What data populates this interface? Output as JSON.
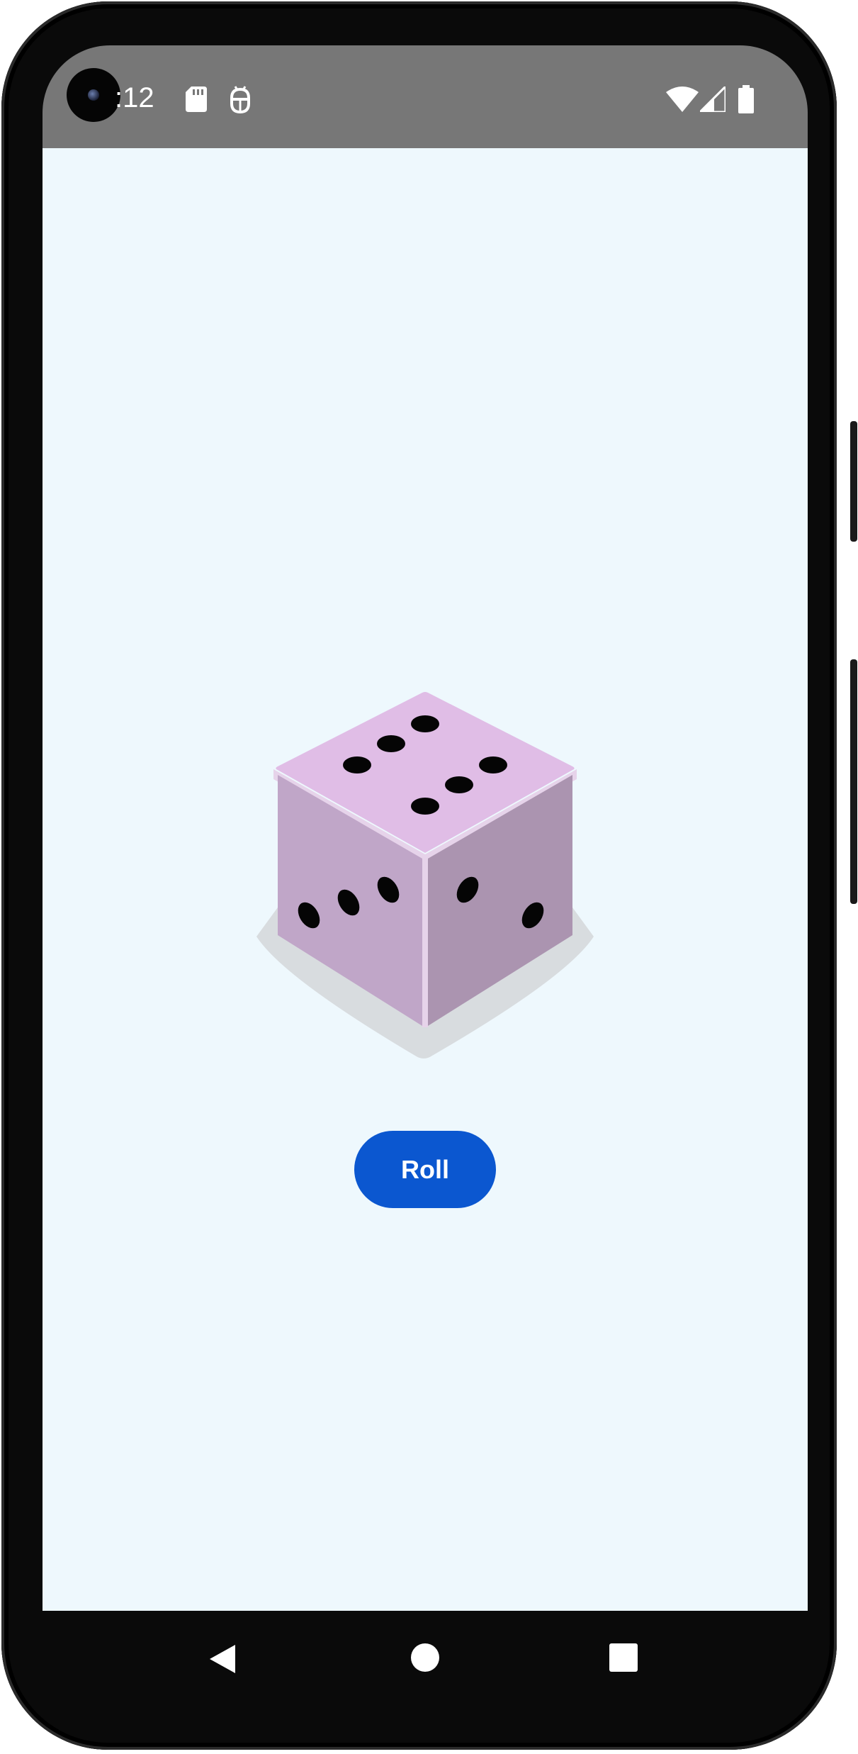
{
  "status_bar": {
    "time": ":12",
    "icons": [
      "sd-card-icon",
      "android-debug-icon",
      "wifi-icon",
      "cell-signal-icon",
      "battery-icon"
    ]
  },
  "dice": {
    "image_name": "dice-six-icon",
    "face_value": 6
  },
  "roll_button": {
    "label": "Roll"
  },
  "nav_bar": {
    "buttons": [
      "back-icon",
      "home-icon",
      "recents-icon"
    ]
  },
  "colors": {
    "status_bar": "#777777",
    "background": "#eef8fd",
    "button": "#0b57d0",
    "dice_top": "#e0bde6",
    "dice_left": "#c0a6c8",
    "dice_right": "#ab94b0"
  }
}
